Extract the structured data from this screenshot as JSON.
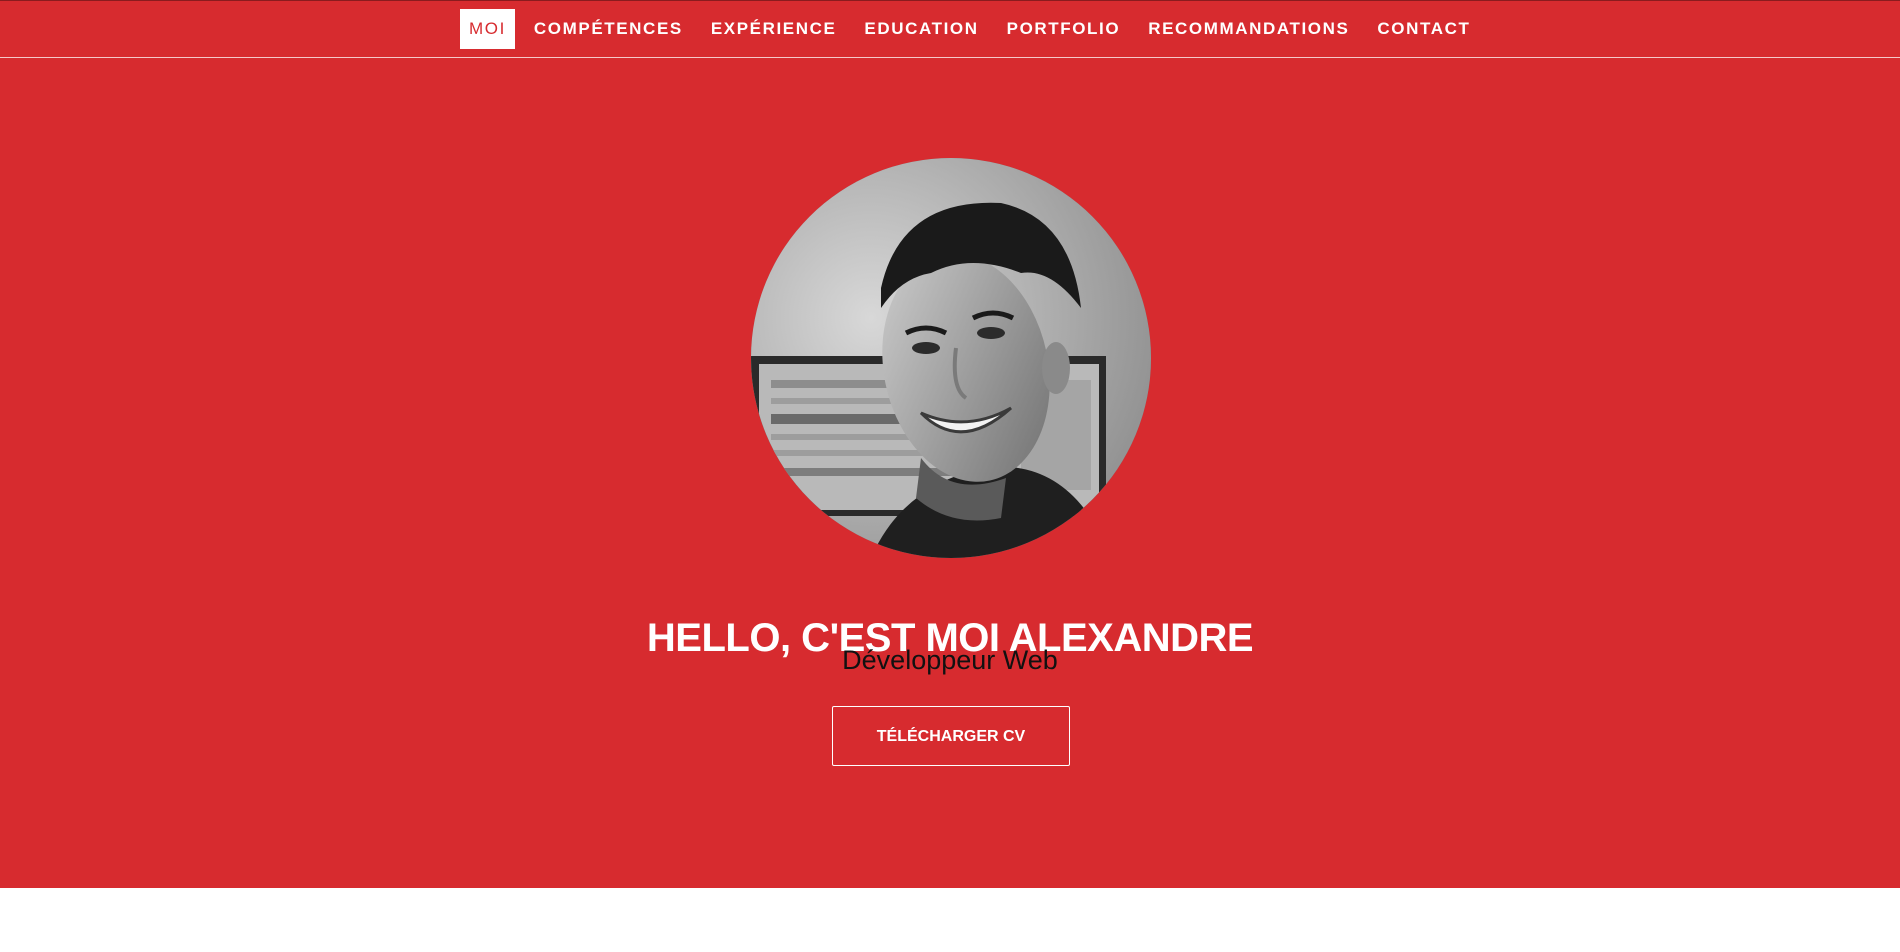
{
  "colors": {
    "hero_background": "#d72b2f",
    "nav_text": "#ffffff",
    "nav_active_background": "#ffffff",
    "nav_active_text": "#d72b2f",
    "subtitle_text": "#111111",
    "page_background": "#ffffff"
  },
  "nav": {
    "items": [
      {
        "label": "MOI",
        "active": true
      },
      {
        "label": "COMPÉTENCES",
        "active": false
      },
      {
        "label": "EXPÉRIENCE",
        "active": false
      },
      {
        "label": "EDUCATION",
        "active": false
      },
      {
        "label": "PORTFOLIO",
        "active": false
      },
      {
        "label": "RECOMMANDATIONS",
        "active": false
      },
      {
        "label": "CONTACT",
        "active": false
      }
    ]
  },
  "hero": {
    "avatar_icon": "profile-photo",
    "title": "HELLO, C'EST MOI ALEXANDRE",
    "subtitle": "Développeur Web",
    "cv_button_label": "TÉLÉCHARGER CV"
  }
}
